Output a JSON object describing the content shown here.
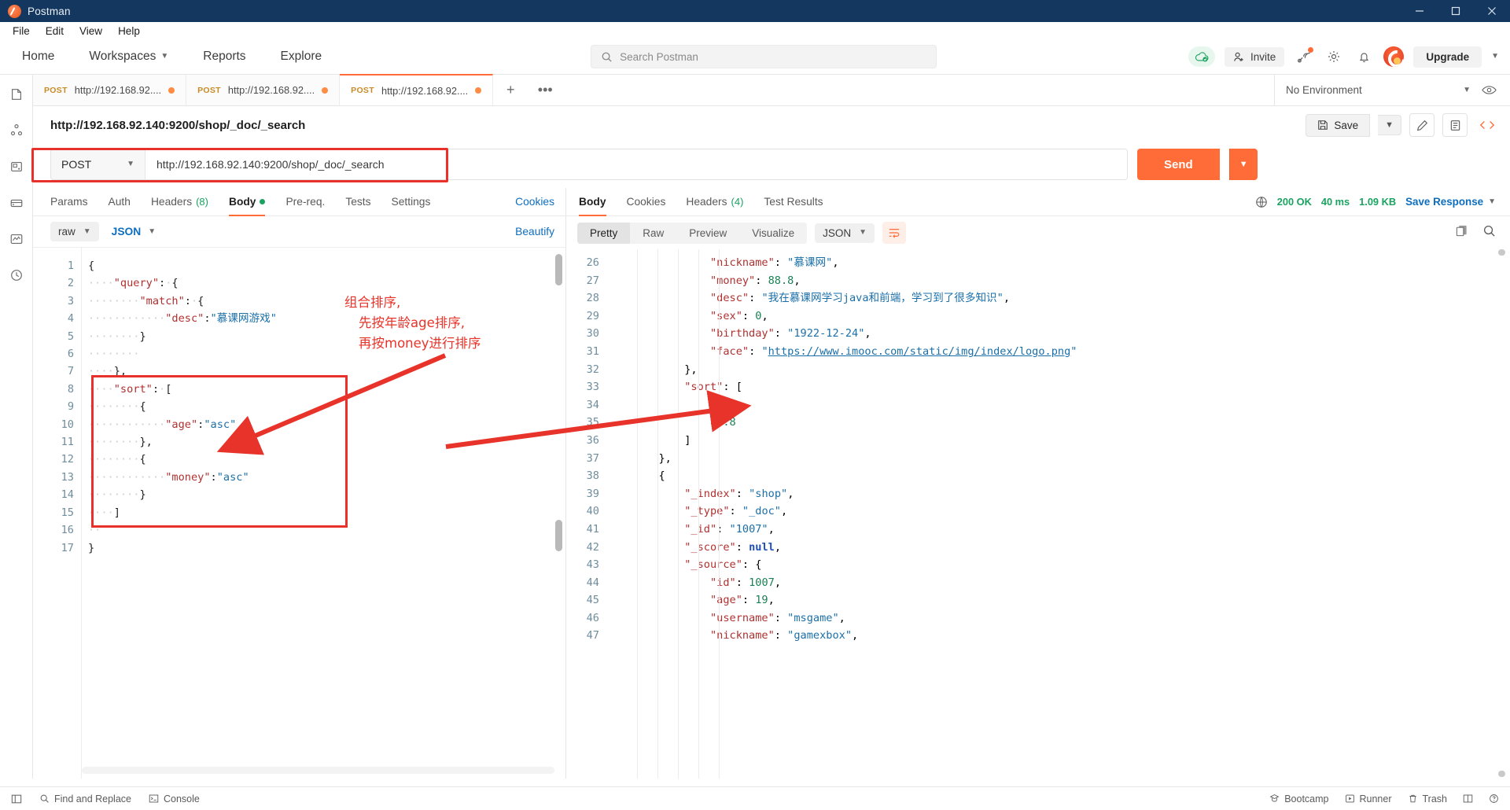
{
  "window": {
    "app_title": "Postman",
    "minimize_icon": "minimize-icon",
    "maximize_icon": "maximize-icon",
    "close_icon": "close-icon"
  },
  "menubar": [
    "File",
    "Edit",
    "View",
    "Help"
  ],
  "topnav": {
    "items": [
      "Home",
      "Workspaces",
      "Reports",
      "Explore"
    ],
    "search_placeholder": "Search Postman",
    "invite_label": "Invite",
    "upgrade_label": "Upgrade"
  },
  "tabstrip": {
    "tabs": [
      {
        "method": "POST",
        "name": "http://192.168.92....",
        "unsaved": true,
        "active": false
      },
      {
        "method": "POST",
        "name": "http://192.168.92....",
        "unsaved": true,
        "active": false
      },
      {
        "method": "POST",
        "name": "http://192.168.92....",
        "unsaved": true,
        "active": true
      }
    ],
    "new_tab_label": "+",
    "more_label": "•••",
    "environment": "No Environment"
  },
  "request": {
    "title": "http://192.168.92.140:9200/shop/_doc/_search",
    "save_label": "Save",
    "method": "POST",
    "url": "http://192.168.92.140:9200/shop/_doc/_search",
    "send_label": "Send",
    "tabs": [
      {
        "label": "Params",
        "active": false
      },
      {
        "label": "Auth",
        "active": false
      },
      {
        "label": "Headers",
        "count": "(8)",
        "active": false
      },
      {
        "label": "Body",
        "dot": true,
        "active": true
      },
      {
        "label": "Pre-req.",
        "active": false
      },
      {
        "label": "Tests",
        "active": false
      },
      {
        "label": "Settings",
        "active": false
      }
    ],
    "cookies_link": "Cookies",
    "body_mode": "raw",
    "body_format": "JSON",
    "beautify_label": "Beautify",
    "body_lines": [
      {
        "n": 1,
        "html": "{"
      },
      {
        "n": 2,
        "html": "<span class=\"dots\">····</span><span class=\"k\">\"query\"</span><span class=\"p\">:</span><span class=\"dots\">·</span><span class=\"p\">{</span>"
      },
      {
        "n": 3,
        "html": "<span class=\"dots\">····</span><span class=\"dots\">····</span><span class=\"k\">\"match\"</span><span class=\"p\">:</span><span class=\"dots\">·</span><span class=\"p\">{</span>"
      },
      {
        "n": 4,
        "html": "<span class=\"dots\">····</span><span class=\"dots\">····</span><span class=\"dots\">····</span><span class=\"k\">\"desc\"</span><span class=\"p\">:</span><span class=\"s\">\"慕课网游戏\"</span>"
      },
      {
        "n": 5,
        "html": "<span class=\"dots\">····</span><span class=\"dots\">····</span><span class=\"p\">}</span>"
      },
      {
        "n": 6,
        "html": "<span class=\"dots\">····</span><span class=\"dots\">····</span>"
      },
      {
        "n": 7,
        "html": "<span class=\"dots\">····</span><span class=\"p\">},</span>"
      },
      {
        "n": 8,
        "html": "<span class=\"dots\">····</span><span class=\"k\">\"sort\"</span><span class=\"p\">:</span><span class=\"dots\">·</span><span class=\"p\">[</span>"
      },
      {
        "n": 9,
        "html": "<span class=\"dots\">····</span><span class=\"dots\">····</span><span class=\"p\">{</span>"
      },
      {
        "n": 10,
        "html": "<span class=\"dots\">····</span><span class=\"dots\">····</span><span class=\"dots\">····</span><span class=\"k\">\"age\"</span><span class=\"p\">:</span><span class=\"s\">\"asc\"</span>"
      },
      {
        "n": 11,
        "html": "<span class=\"dots\">····</span><span class=\"dots\">····</span><span class=\"p\">},</span>"
      },
      {
        "n": 12,
        "html": "<span class=\"dots\">····</span><span class=\"dots\">····</span><span class=\"p\">{</span>"
      },
      {
        "n": 13,
        "html": "<span class=\"dots\">····</span><span class=\"dots\">····</span><span class=\"dots\">····</span><span class=\"k\">\"money\"</span><span class=\"p\">:</span><span class=\"s\">\"asc\"</span>"
      },
      {
        "n": 14,
        "html": "<span class=\"dots\">····</span><span class=\"dots\">····</span><span class=\"p\">}</span>"
      },
      {
        "n": 15,
        "html": "<span class=\"dots\">····</span><span class=\"p\">]</span>"
      },
      {
        "n": 16,
        "html": "<span class=\"dots\">··</span>"
      },
      {
        "n": 17,
        "html": "<span class=\"p\">}</span>"
      }
    ]
  },
  "annotation": {
    "line1": "组合排序,",
    "line2": "先按年龄age排序,",
    "line3": "再按money进行排序",
    "color": "#e8332a"
  },
  "response": {
    "tabs": [
      {
        "label": "Body",
        "active": true
      },
      {
        "label": "Cookies",
        "active": false
      },
      {
        "label": "Headers",
        "count": "(4)",
        "active": false
      },
      {
        "label": "Test Results",
        "active": false
      }
    ],
    "status": "200 OK",
    "time": "40 ms",
    "size": "1.09 KB",
    "save_response_label": "Save Response",
    "view_modes": [
      "Pretty",
      "Raw",
      "Preview",
      "Visualize"
    ],
    "active_view": "Pretty",
    "format": "JSON",
    "copy_icon": "copy-icon",
    "search_icon": "search-icon",
    "lines": [
      {
        "n": 26,
        "html": "                <span class=\"rk\">\"nickname\"</span>: <span class=\"rs\">\"慕课网\"</span>,"
      },
      {
        "n": 27,
        "html": "                <span class=\"rk\">\"money\"</span>: <span class=\"rn\">88.8</span>,"
      },
      {
        "n": 28,
        "html": "                <span class=\"rk\">\"desc\"</span>: <span class=\"rs\">\"我在慕课网学习java和前端，学习到了很多知识\"</span>,"
      },
      {
        "n": 29,
        "html": "                <span class=\"rk\">\"sex\"</span>: <span class=\"rn\">0</span>,"
      },
      {
        "n": 30,
        "html": "                <span class=\"rk\">\"birthday\"</span>: <span class=\"rs\">\"1922-12-24\"</span>,"
      },
      {
        "n": 31,
        "html": "                <span class=\"rk\">\"face\"</span>: <span class=\"rs\">\"</span><span class=\"rlink\">https://www.imooc.com/static/img/index/logo.png</span><span class=\"rs\">\"</span>"
      },
      {
        "n": 32,
        "html": "            <span>},</span>"
      },
      {
        "n": 33,
        "html": "            <span class=\"rk\">\"sort\"</span>: ["
      },
      {
        "n": 34,
        "html": "                <span class=\"rn\">18</span>,"
      },
      {
        "n": 35,
        "html": "                <span class=\"rn\">88.8</span>"
      },
      {
        "n": 36,
        "html": "            ]"
      },
      {
        "n": 37,
        "html": "        },"
      },
      {
        "n": 38,
        "html": "        {"
      },
      {
        "n": 39,
        "html": "            <span class=\"rk\">\"_index\"</span>: <span class=\"rs\">\"shop\"</span>,"
      },
      {
        "n": 40,
        "html": "            <span class=\"rk\">\"_type\"</span>: <span class=\"rs\">\"_doc\"</span>,"
      },
      {
        "n": 41,
        "html": "            <span class=\"rk\">\"_id\"</span>: <span class=\"rs\">\"1007\"</span>,"
      },
      {
        "n": 42,
        "html": "            <span class=\"rk\">\"_score\"</span>: <span class=\"rnull\">null</span>,"
      },
      {
        "n": 43,
        "html": "            <span class=\"rk\">\"_source\"</span>: {"
      },
      {
        "n": 44,
        "html": "                <span class=\"rk\">\"id\"</span>: <span class=\"rn\">1007</span>,"
      },
      {
        "n": 45,
        "html": "                <span class=\"rk\">\"age\"</span>: <span class=\"rn\">19</span>,"
      },
      {
        "n": 46,
        "html": "                <span class=\"rk\">\"username\"</span>: <span class=\"rs\">\"msgame\"</span>,"
      },
      {
        "n": 47,
        "html": "                <span class=\"rk\">\"nickname\"</span>: <span class=\"rs\">\"gamexbox\"</span>,"
      }
    ]
  },
  "statusbar": {
    "find_and_replace": "Find and Replace",
    "console": "Console",
    "bootcamp": "Bootcamp",
    "runner": "Runner",
    "trash": "Trash"
  }
}
